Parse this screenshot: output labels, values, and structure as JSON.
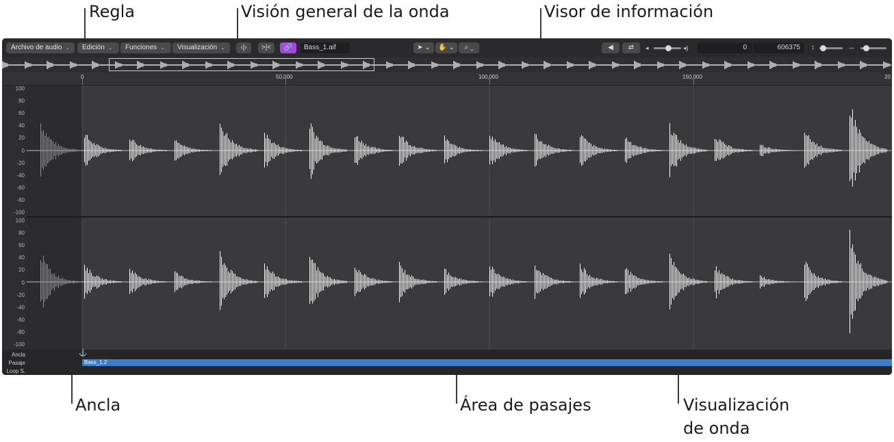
{
  "callouts": {
    "regla": "Regla",
    "vision_general": "Visión general de la onda",
    "visor": "Visor de información",
    "ancla": "Ancla",
    "area_pasajes": "Área de pasajes",
    "visualizacion_1": "Visualización",
    "visualizacion_2": "de onda"
  },
  "toolbar": {
    "menus": [
      "Archivo de audio",
      "Edición",
      "Funciones",
      "Visualización"
    ],
    "filename": "Bass_1.aif",
    "info_start": "0",
    "info_end": "606375"
  },
  "ruler": {
    "labels": [
      "0",
      "50,000",
      "100,000",
      "150,000",
      "20"
    ]
  },
  "yaxis": {
    "ticks": [
      "100",
      "80",
      "60",
      "40",
      "20",
      "0",
      "-20",
      "-40",
      "-60",
      "-80",
      "-100"
    ]
  },
  "rows": {
    "anchor": "Ancla",
    "passage": "Pasaje",
    "loop": "Loop S."
  },
  "passage_name": "Bass_1.2",
  "colors": {
    "background": "#2c2c2e",
    "waveform": "#ffffff",
    "passage": "#3d7dc9",
    "link_button": "#a54ae0"
  }
}
